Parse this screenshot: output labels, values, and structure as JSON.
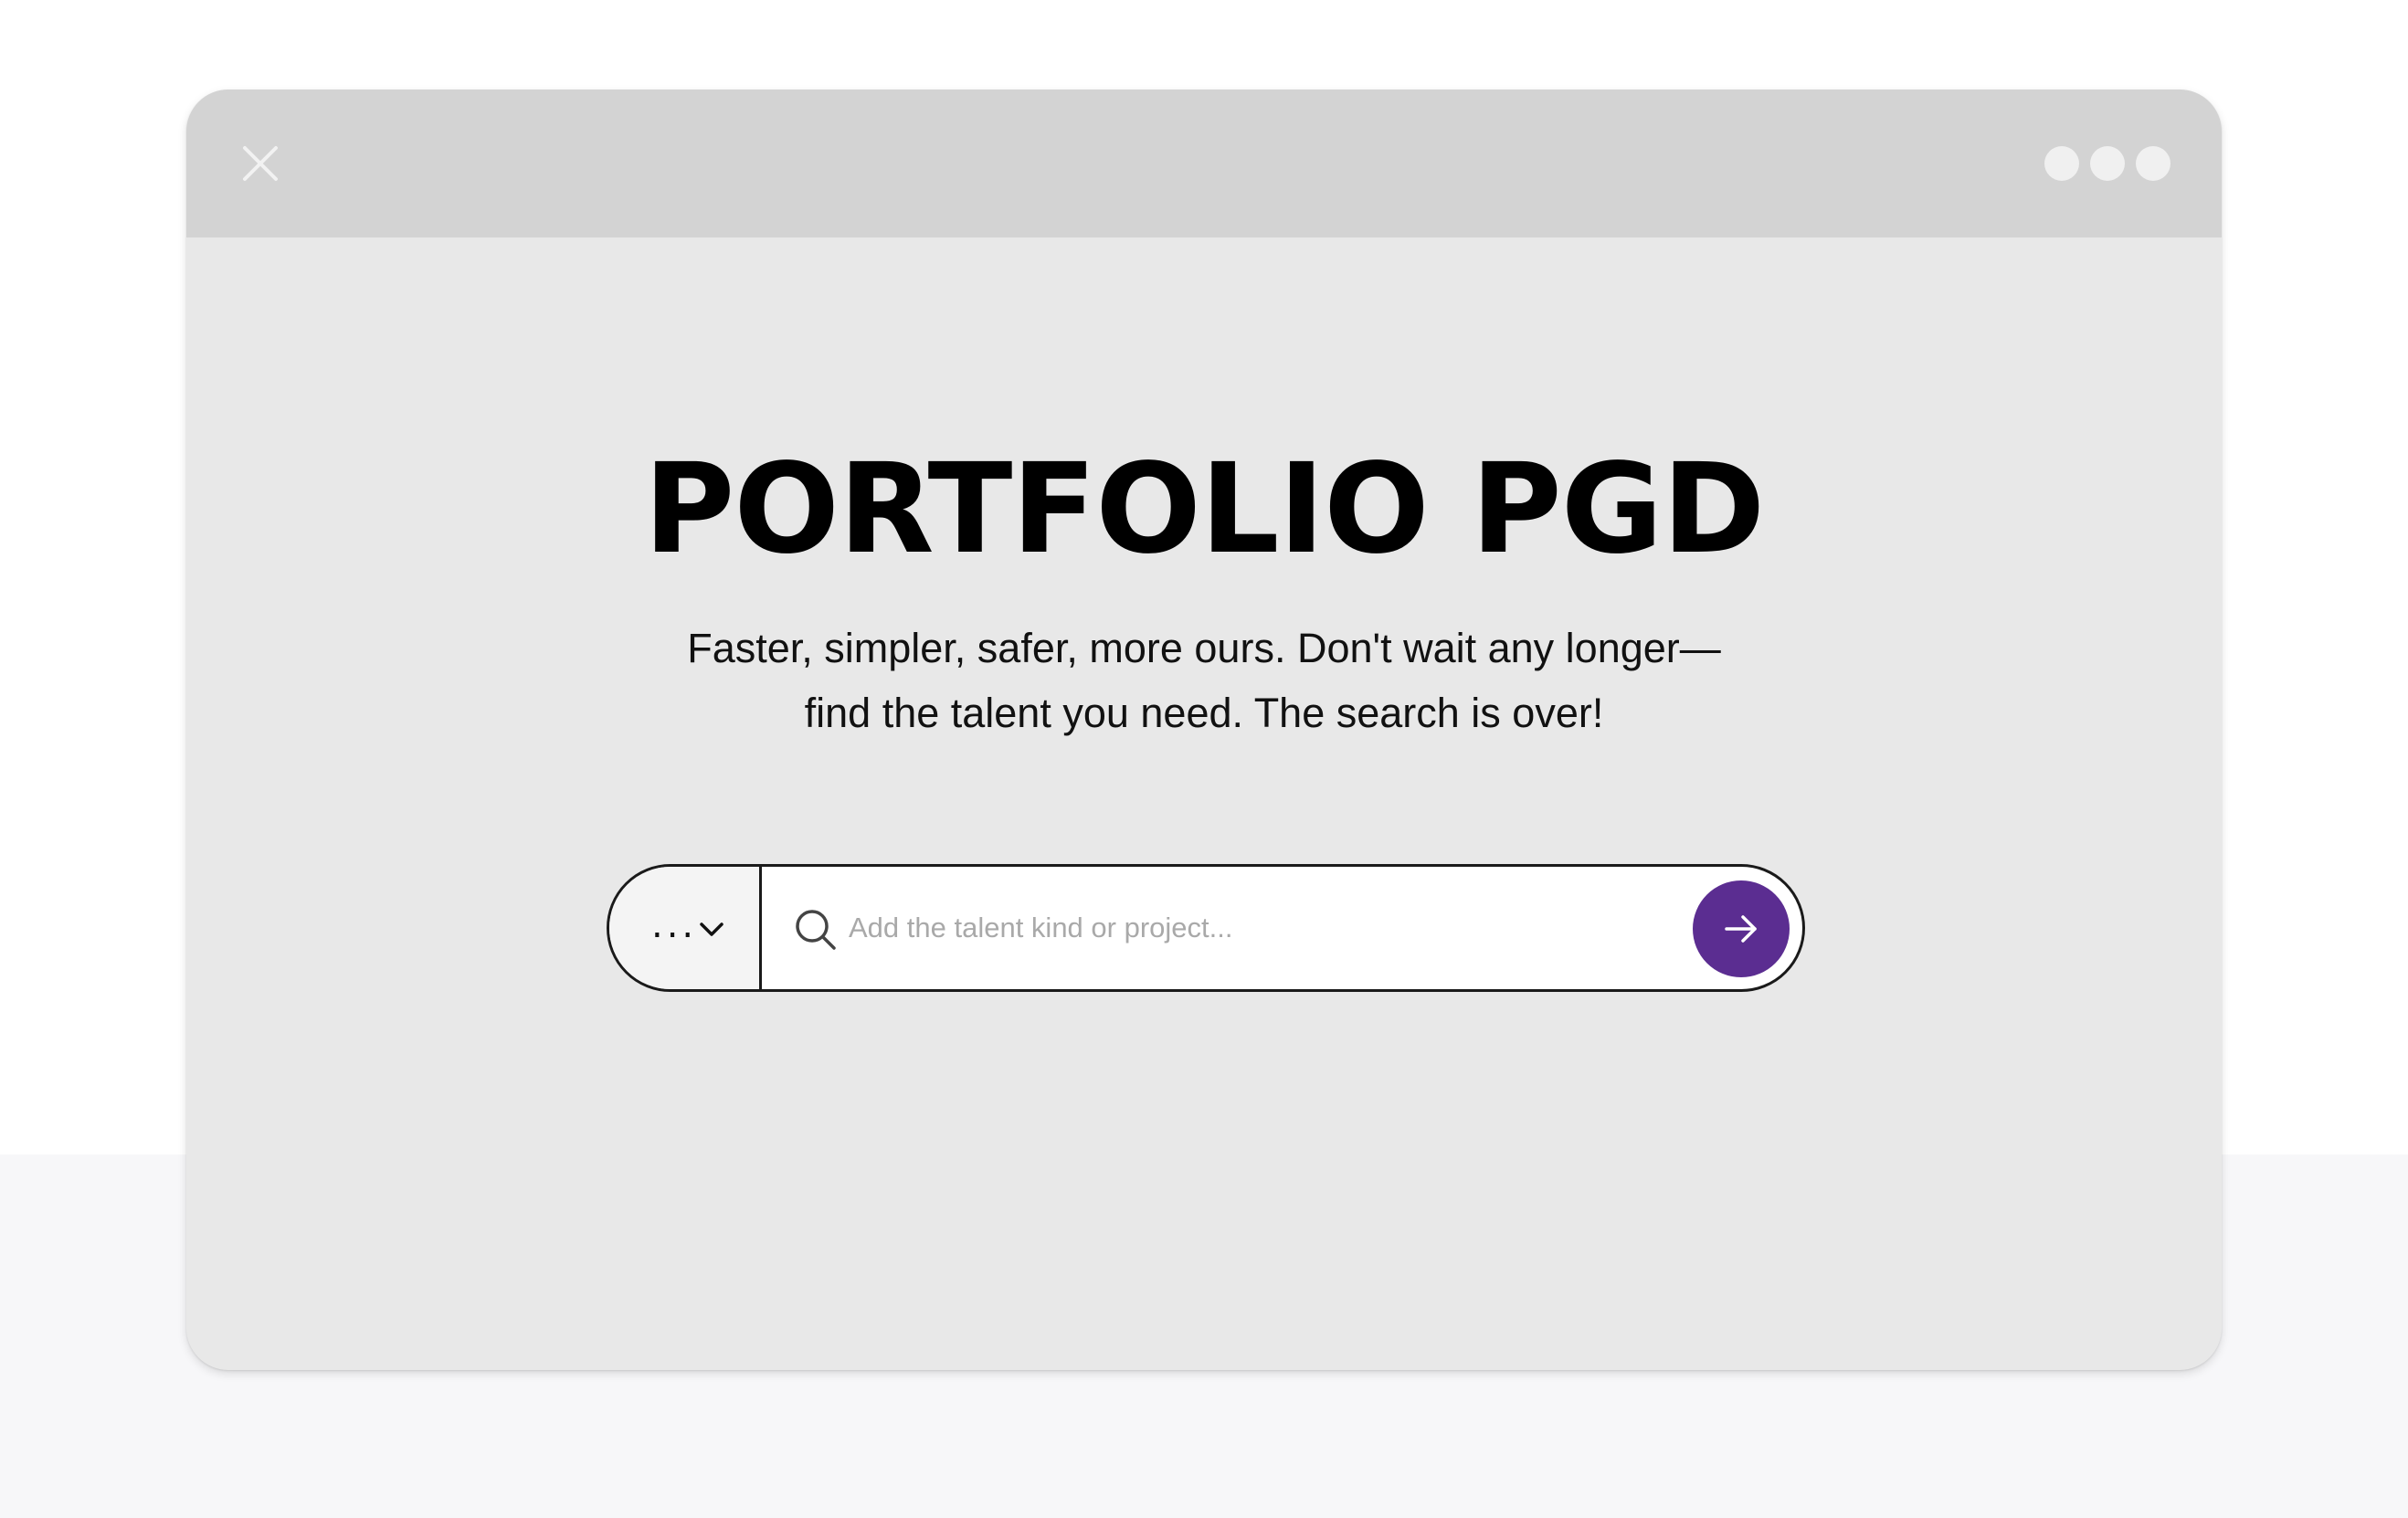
{
  "window": {
    "title": "PORTFOLIO PGD",
    "subtitle": "Faster, simpler, safer, more ours. Don't wait any longer—find the talent you need. The search is over!"
  },
  "titlebar": {
    "close_icon": "close-icon",
    "menu_icon": "more-dots-icon"
  },
  "search": {
    "select_value": "...",
    "select_icon": "chevron-down-icon",
    "placeholder": "Add the talent kind or project...",
    "value": "",
    "search_icon": "search-icon",
    "submit_icon": "arrow-right-icon"
  },
  "colors": {
    "accent": "#5b2d91",
    "window_bg": "#e8e8e8",
    "titlebar_bg": "#d3d3d3"
  }
}
